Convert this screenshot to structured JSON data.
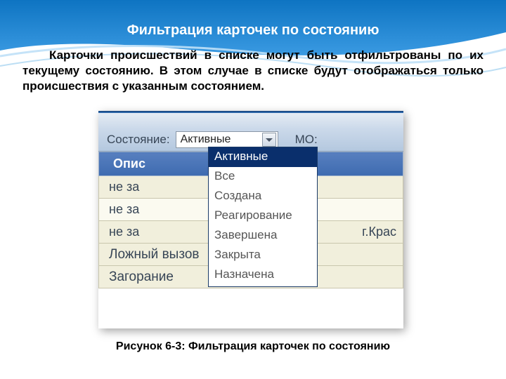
{
  "header": {
    "title": "Фильтрация карточек по состоянию"
  },
  "paragraph": "Карточки происшествий в списке могут быть отфильтрованы по их текущему состоянию. В этом случае в списке будут отображаться только происшествия с указанным состоянием.",
  "ui": {
    "state_label": "Состояние:",
    "state_selected": "Активные",
    "mo_label": "МО:",
    "options": {
      "o0": "Активные",
      "o1": "Все",
      "o2": "Создана",
      "o3": "Реагирование",
      "o4": "Завершена",
      "o5": "Закрыта",
      "o6": "Назначена"
    },
    "th_desc": "Опис",
    "rows": {
      "r0": "не за",
      "r1": "не за",
      "r2": "не за",
      "r2_right": "г.Крас",
      "r3": "Ложный вызов",
      "r4": "Загорание"
    }
  },
  "caption": "Рисунок 6-3: Фильтрация карточек по состоянию"
}
